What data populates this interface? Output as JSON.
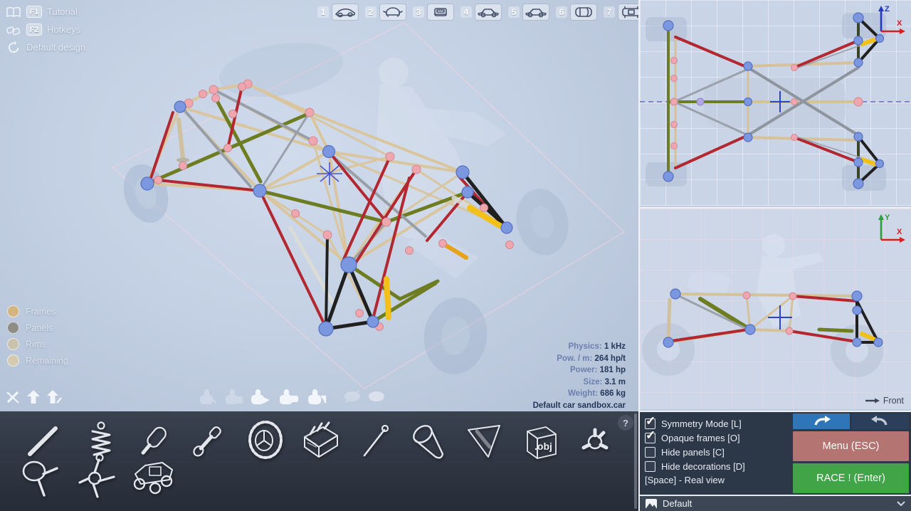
{
  "header": {
    "help_items": [
      {
        "key": "F1",
        "label": "Tutorial"
      },
      {
        "key": "F2",
        "label": "Hotkeys"
      },
      {
        "key": "",
        "label": "Default design"
      }
    ],
    "view_slots": [
      {
        "num": "1"
      },
      {
        "num": "2"
      },
      {
        "num": "3"
      },
      {
        "num": "4"
      },
      {
        "num": "5"
      },
      {
        "num": "6"
      },
      {
        "num": "7"
      }
    ]
  },
  "legend": {
    "items": [
      {
        "label": "Frames",
        "color": "#d4b57f"
      },
      {
        "label": "Panels",
        "color": "#8e8e87"
      },
      {
        "label": "Rims",
        "color": "#c9c2ae"
      },
      {
        "label": "Remaining",
        "color": "#d3cbb0"
      }
    ]
  },
  "stats": {
    "rows": [
      {
        "label": "Physics:",
        "value": "1 kHz"
      },
      {
        "label": "Pow. / m:",
        "value": "264 hp/t"
      },
      {
        "label": "Power:",
        "value": "181 hp"
      },
      {
        "label": "Size:",
        "value": "3.1 m"
      },
      {
        "label": "Weight:",
        "value": "686 kg"
      }
    ],
    "file_name": "Default car sandbox.car"
  },
  "palette": {
    "obj_label": ".obj",
    "help_button": "?",
    "parts": [
      "rod",
      "spring-shock",
      "tube",
      "actuator",
      "wheel",
      "engine",
      "antenna",
      "cone",
      "panel-triangle",
      "obj-import",
      "ball-joint",
      "steering-wheel",
      "hub-connector",
      "sample-buggy"
    ]
  },
  "toolbar_icons": [
    "no-draw-pencil",
    "raise-arrow",
    "raise-edit-arrow",
    "grab-tool-1",
    "grab-tool-2",
    "grab-flag-tool",
    "grab-box-tool",
    "grab-corner-tool",
    "hide-eye",
    "show-eye",
    "video-camera"
  ],
  "options": {
    "checkboxes": [
      {
        "label": "Symmetry Mode [L]",
        "checked": true
      },
      {
        "label": "Opaque frames [O]",
        "checked": true
      },
      {
        "label": "Hide panels [C]",
        "checked": false
      },
      {
        "label": "Hide decorations [D]",
        "checked": false
      }
    ],
    "real_view_hint": "[Space] - Real view",
    "menu_button": "Menu (ESC)",
    "race_button": "RACE ! (Enter)"
  },
  "preset": {
    "value": "Default"
  },
  "ortho": {
    "top_axis": {
      "v": "Z",
      "h": "X"
    },
    "side_axis": {
      "v": "Y",
      "h": "X"
    },
    "front_label": "Front"
  },
  "colors": {
    "race_green": "#41a447",
    "menu_rose": "#b37472",
    "undo_blue": "#2e76b8",
    "frame_tan": "#d9c69e",
    "frame_red": "#b22730",
    "frame_olive": "#6f7d22",
    "frame_black": "#202020",
    "joint_blue": "#7b97e0",
    "joint_pink": "#f2a8b0",
    "shock_yellow": "#f2c118",
    "axis_z_blue": "#2238c8",
    "axis_y_green": "#2ba03a",
    "axis_x_red": "#d42020"
  }
}
